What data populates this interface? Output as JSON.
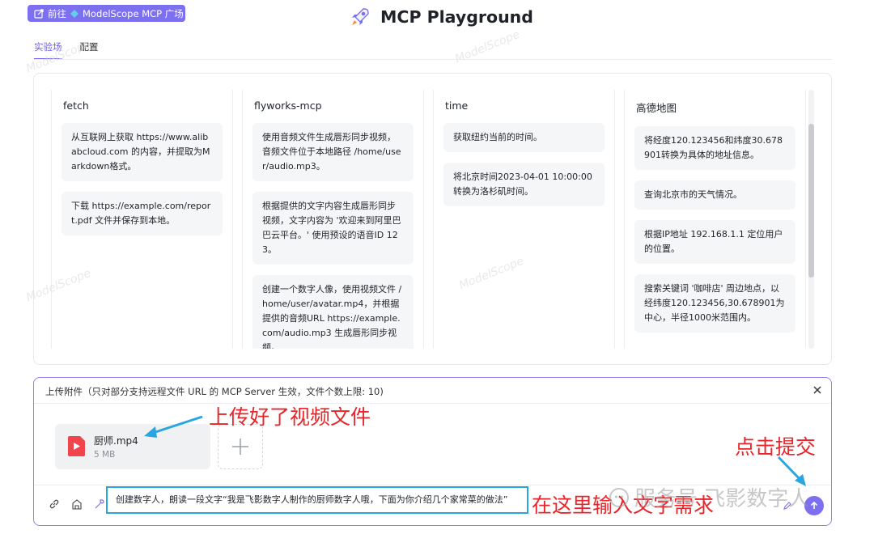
{
  "header": {
    "goto_prefix": "前往",
    "goto_label": "ModelScope MCP 广场",
    "title": "MCP Playground"
  },
  "tabs": [
    {
      "label": "实验场",
      "active": true
    },
    {
      "label": "配置",
      "active": false
    }
  ],
  "columns": [
    {
      "title": "fetch",
      "cards": [
        "从互联网上获取 https://www.alibabcloud.com 的内容，并提取为Markdown格式。",
        "下载 https://example.com/report.pdf 文件并保存到本地。"
      ]
    },
    {
      "title": "flyworks-mcp",
      "cards": [
        "使用音频文件生成唇形同步视频，音频文件位于本地路径 /home/user/audio.mp3。",
        "根据提供的文字内容生成唇形同步视频，文字内容为 '欢迎来到阿里巴巴云平台。' 使用预设的语音ID 123。",
        "创建一个数字人像，使用视频文件 /home/user/avatar.mp4，并根据提供的音频URL https://example.com/audio.mp3 生成唇形同步视频。"
      ]
    },
    {
      "title": "time",
      "cards": [
        "获取纽约当前的时间。",
        "将北京时间2023-04-01 10:00:00转换为洛杉矶时间。"
      ]
    },
    {
      "title": "高德地图",
      "cards": [
        "将经度120.123456和纬度30.678901转换为具体的地址信息。",
        "查询北京市的天气情况。",
        "根据IP地址 192.168.1.1 定位用户的位置。",
        "搜索关键词 '咖啡店' 周边地点，以经纬度120.123456,30.678901为中心，半径1000米范围内。"
      ]
    }
  ],
  "upload": {
    "header_text": "上传附件（只对部分支持远程文件 URL 的 MCP Server 生效，文件个数上限: 10)",
    "file": {
      "name": "厨师.mp4",
      "size": "5 MB"
    }
  },
  "input": {
    "value": "创建数字人，朗读一段文字“我是飞影数字人制作的厨师数字人哦，下面为你介绍几个家常菜的做法”"
  },
  "annotations": {
    "uploaded": "上传好了视频文件",
    "submit": "点击提交",
    "type_here": "在这里输入文字需求"
  },
  "watermark": {
    "text": "服务号 飞影数字人",
    "faint": "ModelScope"
  },
  "colors": {
    "accent": "#7c6ff0",
    "annotation_red": "#e8252a",
    "annotation_blue": "#29a6e0"
  }
}
